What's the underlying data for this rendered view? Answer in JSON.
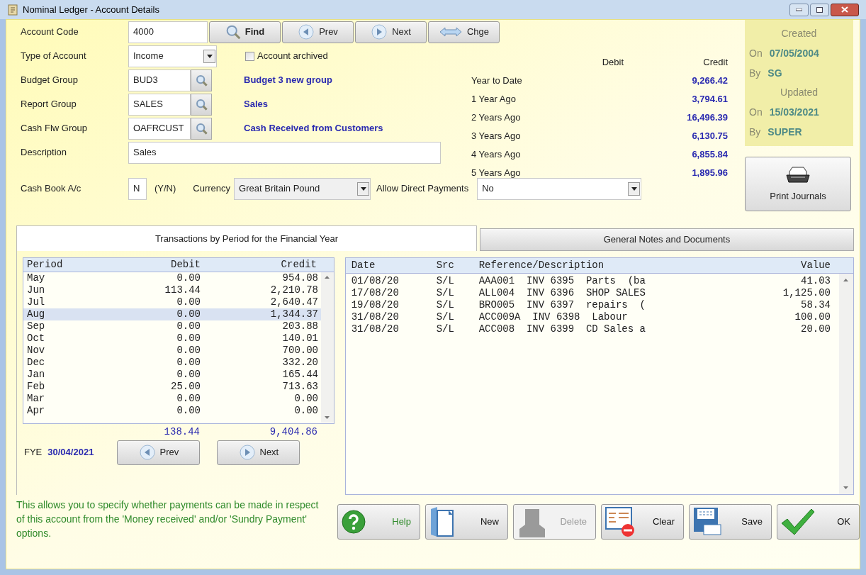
{
  "window": {
    "title": "Nominal Ledger  -  Account Details"
  },
  "header_buttons": [
    {
      "kind": "find",
      "label": "Find"
    },
    {
      "kind": "prev",
      "label": "Prev"
    },
    {
      "kind": "next",
      "label": "Next"
    },
    {
      "kind": "change",
      "label": "Chge"
    }
  ],
  "form_rows": [
    {
      "kind": "text",
      "label": "Account Code",
      "value": "4000"
    },
    {
      "kind": "dropdown",
      "label": "Type of Account",
      "value": "Income",
      "checkbox": {
        "label": "Account archived",
        "checked": false
      }
    },
    {
      "kind": "lookup",
      "label": "Budget Group",
      "value": "BUD3",
      "description": "Budget 3 new group"
    },
    {
      "kind": "lookup",
      "label": "Report Group",
      "value": "SALES",
      "description": "Sales"
    },
    {
      "kind": "lookup",
      "label": "Cash Flw Group",
      "value": "OAFRCUST",
      "description": "Cash Received from Customers"
    },
    {
      "kind": "wide",
      "label": "Description",
      "value": "Sales"
    }
  ],
  "cash_book": {
    "label": "Cash Book A/c",
    "value": "N",
    "hint": "(Y/N)",
    "currency_label": "Currency",
    "currency": "Great Britain Pound",
    "direct_label": "Allow Direct Payments",
    "direct": "No"
  },
  "history": {
    "columns": [
      "Debit",
      "Credit"
    ],
    "rows": [
      {
        "label": "Year to Date",
        "credit": "9,266.42"
      },
      {
        "label": "1 Year Ago",
        "credit": "3,794.61"
      },
      {
        "label": "2 Years Ago",
        "credit": "16,496.39"
      },
      {
        "label": "3 Years Ago",
        "credit": "6,130.75"
      },
      {
        "label": "4 Years Ago",
        "credit": "6,855.84"
      },
      {
        "label": "5 Years Ago",
        "credit": "1,895.96"
      }
    ]
  },
  "audit": {
    "created_title": "Created",
    "created_on_label": "On",
    "created_on": "07/05/2004",
    "created_by_label": "By",
    "created_by": "SG",
    "updated_title": "Updated",
    "updated_on_label": "On",
    "updated_on": "15/03/2021",
    "updated_by_label": "By",
    "updated_by": "SUPER"
  },
  "print_button": "Print Journals",
  "tabs": [
    {
      "label": "Transactions by Period for the Financial Year",
      "selected": true
    },
    {
      "label": "General Notes and Documents",
      "selected": false
    }
  ],
  "periods": {
    "columns": [
      "Period",
      "Debit",
      "Credit"
    ],
    "rows": [
      {
        "period": "May",
        "debit": "0.00",
        "credit": "954.08",
        "selected": false
      },
      {
        "period": "Jun",
        "debit": "113.44",
        "credit": "2,210.78",
        "selected": false
      },
      {
        "period": "Jul",
        "debit": "0.00",
        "credit": "2,640.47",
        "selected": false
      },
      {
        "period": "Aug",
        "debit": "0.00",
        "credit": "1,344.37",
        "selected": true
      },
      {
        "period": "Sep",
        "debit": "0.00",
        "credit": "203.88",
        "selected": false
      },
      {
        "period": "Oct",
        "debit": "0.00",
        "credit": "140.01",
        "selected": false
      },
      {
        "period": "Nov",
        "debit": "0.00",
        "credit": "700.00",
        "selected": false
      },
      {
        "period": "Dec",
        "debit": "0.00",
        "credit": "332.20",
        "selected": false
      },
      {
        "period": "Jan",
        "debit": "0.00",
        "credit": "165.44",
        "selected": false
      },
      {
        "period": "Feb",
        "debit": "25.00",
        "credit": "713.63",
        "selected": false
      },
      {
        "period": "Mar",
        "debit": "0.00",
        "credit": "0.00",
        "selected": false
      },
      {
        "period": "Apr",
        "debit": "0.00",
        "credit": "0.00",
        "selected": false
      }
    ],
    "totals": {
      "debit": "138.44",
      "credit": "9,404.86"
    },
    "fye_label": "FYE",
    "fye": "30/04/2021",
    "prev": "Prev",
    "next": "Next"
  },
  "transactions": {
    "columns": [
      "Date",
      "Src",
      "Reference/Description",
      "Value"
    ],
    "rows": [
      {
        "date": "01/08/20",
        "src": "S/L",
        "reference": "AAA001  INV 6395  Parts  (ba",
        "value": "41.03"
      },
      {
        "date": "17/08/20",
        "src": "S/L",
        "reference": "ALL004  INV 6396  SHOP SALES",
        "value": "1,125.00"
      },
      {
        "date": "19/08/20",
        "src": "S/L",
        "reference": "BRO005  INV 6397  repairs  (",
        "value": "58.34"
      },
      {
        "date": "31/08/20",
        "src": "S/L",
        "reference": "ACC009A  INV 6398  Labour",
        "value": "100.00"
      },
      {
        "date": "31/08/20",
        "src": "S/L",
        "reference": "ACC008  INV 6399  CD Sales a",
        "value": "20.00"
      }
    ]
  },
  "hint": "This allows you to specify whether payments can be made in respect of this account from the 'Money received' and/or 'Sundry Payment' options.",
  "actions": [
    {
      "kind": "help",
      "label": "Help",
      "disabled": false
    },
    {
      "kind": "new",
      "label": "New",
      "disabled": false
    },
    {
      "kind": "delete",
      "label": "Delete",
      "disabled": true
    },
    {
      "kind": "clear",
      "label": "Clear",
      "disabled": false
    },
    {
      "kind": "save",
      "label": "Save",
      "disabled": false
    },
    {
      "kind": "ok",
      "label": "OK",
      "disabled": false
    }
  ]
}
